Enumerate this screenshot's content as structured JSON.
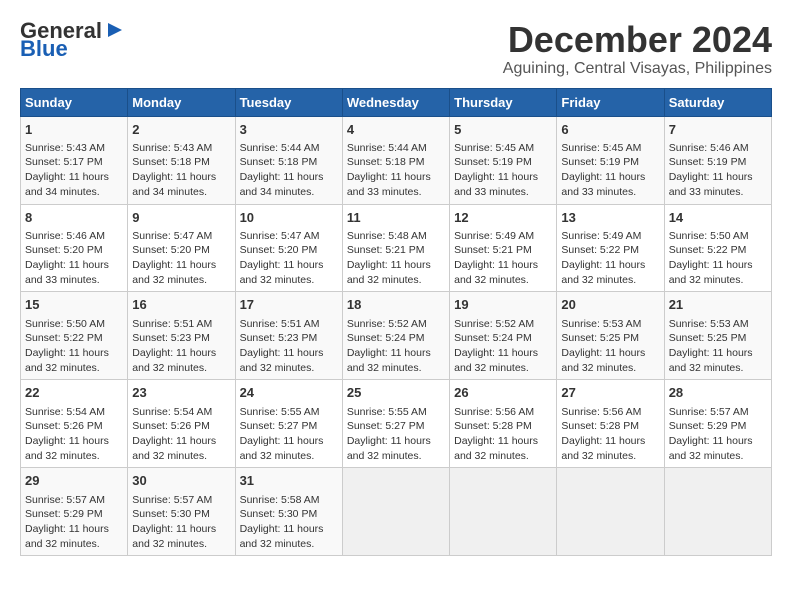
{
  "logo": {
    "line1": "General",
    "line2": "Blue"
  },
  "title": "December 2024",
  "subtitle": "Aguining, Central Visayas, Philippines",
  "headers": [
    "Sunday",
    "Monday",
    "Tuesday",
    "Wednesday",
    "Thursday",
    "Friday",
    "Saturday"
  ],
  "weeks": [
    [
      {
        "day": "1",
        "sunrise": "5:43 AM",
        "sunset": "5:17 PM",
        "daylight": "11 hours and 34 minutes."
      },
      {
        "day": "2",
        "sunrise": "5:43 AM",
        "sunset": "5:18 PM",
        "daylight": "11 hours and 34 minutes."
      },
      {
        "day": "3",
        "sunrise": "5:44 AM",
        "sunset": "5:18 PM",
        "daylight": "11 hours and 34 minutes."
      },
      {
        "day": "4",
        "sunrise": "5:44 AM",
        "sunset": "5:18 PM",
        "daylight": "11 hours and 33 minutes."
      },
      {
        "day": "5",
        "sunrise": "5:45 AM",
        "sunset": "5:19 PM",
        "daylight": "11 hours and 33 minutes."
      },
      {
        "day": "6",
        "sunrise": "5:45 AM",
        "sunset": "5:19 PM",
        "daylight": "11 hours and 33 minutes."
      },
      {
        "day": "7",
        "sunrise": "5:46 AM",
        "sunset": "5:19 PM",
        "daylight": "11 hours and 33 minutes."
      }
    ],
    [
      {
        "day": "8",
        "sunrise": "5:46 AM",
        "sunset": "5:20 PM",
        "daylight": "11 hours and 33 minutes."
      },
      {
        "day": "9",
        "sunrise": "5:47 AM",
        "sunset": "5:20 PM",
        "daylight": "11 hours and 32 minutes."
      },
      {
        "day": "10",
        "sunrise": "5:47 AM",
        "sunset": "5:20 PM",
        "daylight": "11 hours and 32 minutes."
      },
      {
        "day": "11",
        "sunrise": "5:48 AM",
        "sunset": "5:21 PM",
        "daylight": "11 hours and 32 minutes."
      },
      {
        "day": "12",
        "sunrise": "5:49 AM",
        "sunset": "5:21 PM",
        "daylight": "11 hours and 32 minutes."
      },
      {
        "day": "13",
        "sunrise": "5:49 AM",
        "sunset": "5:22 PM",
        "daylight": "11 hours and 32 minutes."
      },
      {
        "day": "14",
        "sunrise": "5:50 AM",
        "sunset": "5:22 PM",
        "daylight": "11 hours and 32 minutes."
      }
    ],
    [
      {
        "day": "15",
        "sunrise": "5:50 AM",
        "sunset": "5:22 PM",
        "daylight": "11 hours and 32 minutes."
      },
      {
        "day": "16",
        "sunrise": "5:51 AM",
        "sunset": "5:23 PM",
        "daylight": "11 hours and 32 minutes."
      },
      {
        "day": "17",
        "sunrise": "5:51 AM",
        "sunset": "5:23 PM",
        "daylight": "11 hours and 32 minutes."
      },
      {
        "day": "18",
        "sunrise": "5:52 AM",
        "sunset": "5:24 PM",
        "daylight": "11 hours and 32 minutes."
      },
      {
        "day": "19",
        "sunrise": "5:52 AM",
        "sunset": "5:24 PM",
        "daylight": "11 hours and 32 minutes."
      },
      {
        "day": "20",
        "sunrise": "5:53 AM",
        "sunset": "5:25 PM",
        "daylight": "11 hours and 32 minutes."
      },
      {
        "day": "21",
        "sunrise": "5:53 AM",
        "sunset": "5:25 PM",
        "daylight": "11 hours and 32 minutes."
      }
    ],
    [
      {
        "day": "22",
        "sunrise": "5:54 AM",
        "sunset": "5:26 PM",
        "daylight": "11 hours and 32 minutes."
      },
      {
        "day": "23",
        "sunrise": "5:54 AM",
        "sunset": "5:26 PM",
        "daylight": "11 hours and 32 minutes."
      },
      {
        "day": "24",
        "sunrise": "5:55 AM",
        "sunset": "5:27 PM",
        "daylight": "11 hours and 32 minutes."
      },
      {
        "day": "25",
        "sunrise": "5:55 AM",
        "sunset": "5:27 PM",
        "daylight": "11 hours and 32 minutes."
      },
      {
        "day": "26",
        "sunrise": "5:56 AM",
        "sunset": "5:28 PM",
        "daylight": "11 hours and 32 minutes."
      },
      {
        "day": "27",
        "sunrise": "5:56 AM",
        "sunset": "5:28 PM",
        "daylight": "11 hours and 32 minutes."
      },
      {
        "day": "28",
        "sunrise": "5:57 AM",
        "sunset": "5:29 PM",
        "daylight": "11 hours and 32 minutes."
      }
    ],
    [
      {
        "day": "29",
        "sunrise": "5:57 AM",
        "sunset": "5:29 PM",
        "daylight": "11 hours and 32 minutes."
      },
      {
        "day": "30",
        "sunrise": "5:57 AM",
        "sunset": "5:30 PM",
        "daylight": "11 hours and 32 minutes."
      },
      {
        "day": "31",
        "sunrise": "5:58 AM",
        "sunset": "5:30 PM",
        "daylight": "11 hours and 32 minutes."
      },
      null,
      null,
      null,
      null
    ]
  ]
}
